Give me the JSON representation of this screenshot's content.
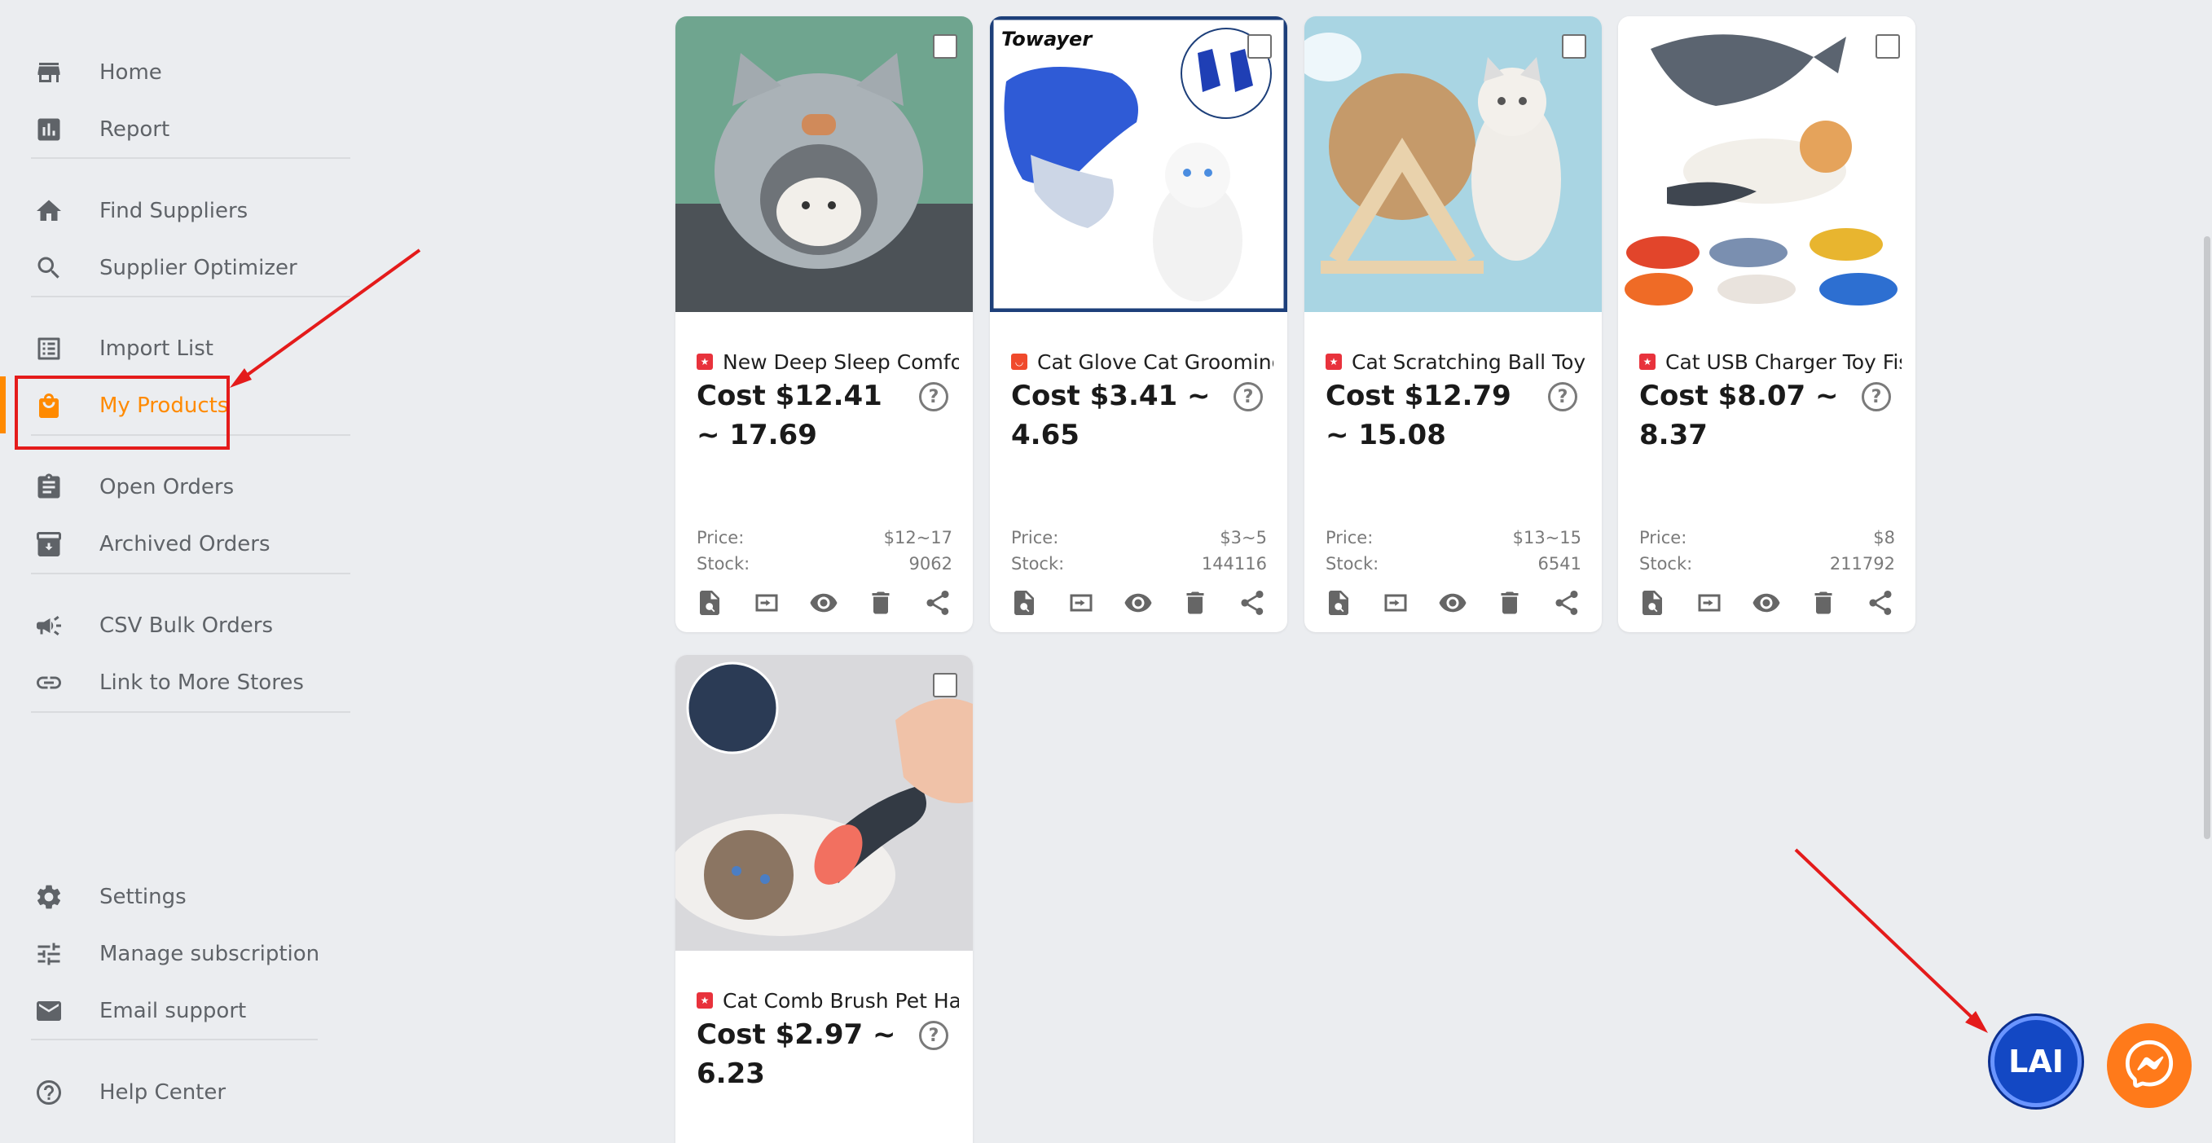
{
  "sidebar": {
    "items": [
      {
        "label": "Home",
        "icon": "store-icon"
      },
      {
        "label": "Report",
        "icon": "bar-chart-icon"
      },
      {
        "label": "Find Suppliers",
        "icon": "home-icon"
      },
      {
        "label": "Supplier Optimizer",
        "icon": "search-icon"
      },
      {
        "label": "Import List",
        "icon": "list-icon"
      },
      {
        "label": "My Products",
        "icon": "shopping-bag-icon",
        "active": true
      },
      {
        "label": "Open Orders",
        "icon": "clipboard-icon"
      },
      {
        "label": "Archived Orders",
        "icon": "archive-icon"
      },
      {
        "label": "CSV Bulk Orders",
        "icon": "megaphone-icon"
      },
      {
        "label": "Link to More Stores",
        "icon": "link-icon"
      },
      {
        "label": "Settings",
        "icon": "gear-icon"
      },
      {
        "label": "Manage subscription",
        "icon": "sliders-icon"
      },
      {
        "label": "Email support",
        "icon": "mail-icon"
      },
      {
        "label": "Help Center",
        "icon": "help-circle-icon"
      }
    ]
  },
  "products": [
    {
      "title": "New Deep Sleep Comfor",
      "cost": "Cost $12.41 ~ 17.69",
      "price_label": "Price:",
      "price": "$12~17",
      "stock_label": "Stock:",
      "stock": "9062"
    },
    {
      "title": "Cat Glove Cat Grooming",
      "cost": "Cost $3.41 ~ 4.65",
      "price_label": "Price:",
      "price": "$3~5",
      "stock_label": "Stock:",
      "stock": "144116",
      "brand": "Towayer"
    },
    {
      "title": "Cat Scratching Ball Toy K",
      "cost": "Cost $12.79 ~ 15.08",
      "price_label": "Price:",
      "price": "$13~15",
      "stock_label": "Stock:",
      "stock": "6541"
    },
    {
      "title": "Cat USB Charger Toy Fisl",
      "cost": "Cost $8.07 ~ 8.37",
      "price_label": "Price:",
      "price": "$8",
      "stock_label": "Stock:",
      "stock": "211792"
    },
    {
      "title": "Cat Comb Brush Pet Hai",
      "cost": "Cost $2.97 ~ 6.23"
    }
  ],
  "help_glyph": "?",
  "fab": {
    "lai_label": "LAI"
  },
  "colors": {
    "accent": "#ff8a00",
    "annotation": "#e41b1b",
    "lai": "#1348c4",
    "messenger": "#ff7a1a"
  }
}
